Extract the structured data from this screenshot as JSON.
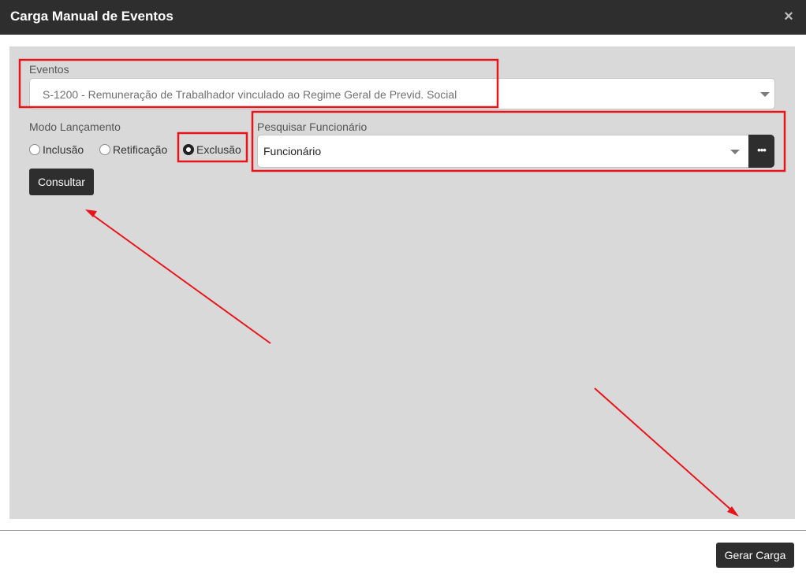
{
  "modal": {
    "title": "Carga Manual de Eventos",
    "close_symbol": "×"
  },
  "form": {
    "eventos_label": "Eventos",
    "eventos_value": "S-1200 - Remuneração de Trabalhador vinculado ao Regime Geral de Previd. Social",
    "modo_label": "Modo Lançamento",
    "modos": [
      {
        "label": "Inclusão",
        "checked": false
      },
      {
        "label": "Retificação",
        "checked": false
      },
      {
        "label": "Exclusão",
        "checked": true
      }
    ],
    "pesquisar_label": "Pesquisar Funcionário",
    "funcionario_value": "Funcionário",
    "more_symbol": "•••",
    "consultar_label": "Consultar"
  },
  "footer": {
    "gerar_label": "Gerar Carga"
  },
  "icons": {
    "close": "close-icon",
    "caret": "chevron-down-icon",
    "more": "ellipsis-icon"
  },
  "colors": {
    "header_bg": "#2e2e2e",
    "body_bg": "#d9d9d9",
    "button_bg": "#2e2e2e",
    "annotation": "#e8141a"
  }
}
